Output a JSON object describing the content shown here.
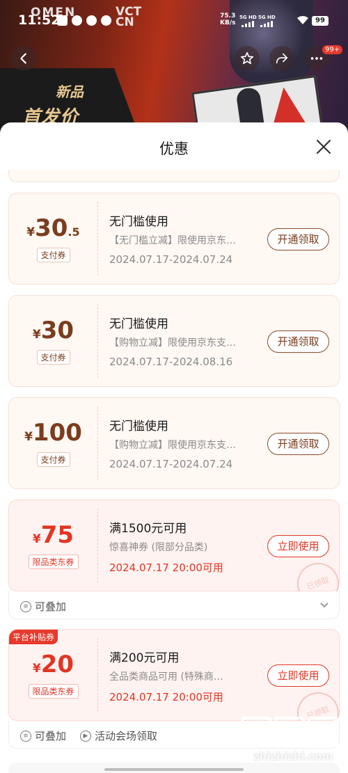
{
  "status_bar": {
    "time": "11:52",
    "net_speed": "75.3",
    "net_unit": "KB/s",
    "sim1": "5G HD",
    "sim2": "5G HD",
    "battery": "99"
  },
  "hero": {
    "brand_left": "OMEN",
    "brand_right_1": "VCT",
    "brand_right_2": "CN",
    "badge_line1": "新品",
    "badge_line2": "首发价"
  },
  "header": {
    "more_badge": "99+"
  },
  "sheet": {
    "title": "优惠"
  },
  "coupons": [
    {
      "currency": "¥",
      "amount": "30",
      "amount_decimal": ".5",
      "tag": "支付券",
      "title": "无门槛使用",
      "desc": "【无门槛立减】限使用京东…",
      "validity": "2024.07.17-2024.07.24",
      "action": "开通领取"
    },
    {
      "currency": "¥",
      "amount": "30",
      "amount_decimal": "",
      "tag": "支付券",
      "title": "无门槛使用",
      "desc": "【购物立减】限使用京东支…",
      "validity": "2024.07.17-2024.08.16",
      "action": "开通领取"
    },
    {
      "currency": "¥",
      "amount": "100",
      "amount_decimal": "",
      "tag": "支付券",
      "title": "无门槛使用",
      "desc": "【购物立减】限使用京东支…",
      "validity": "2024.07.17-2024.07.24",
      "action": "开通领取"
    },
    {
      "currency": "¥",
      "amount": "75",
      "amount_decimal": "",
      "tag": "限品类东券",
      "title": "满1500元可用",
      "desc": "惊喜神券 (限部分品类)",
      "validity": "2024.07.17 20:00可用",
      "action": "立即使用",
      "stamp": "已领取",
      "footer_stackable": "可叠加"
    },
    {
      "flag": "平台补贴券",
      "currency": "¥",
      "amount": "20",
      "amount_decimal": "",
      "tag": "限品类东券",
      "title": "满200元可用",
      "desc": "全品类商品可用 (特殊商…",
      "validity": "2024.07.17 20:00可用",
      "action": "立即使用",
      "stamp": "已领取",
      "footer_stackable": "可叠加",
      "footer_source": "活动会场领取"
    }
  ],
  "watermark": {
    "text": "zhizhizhi.com"
  }
}
